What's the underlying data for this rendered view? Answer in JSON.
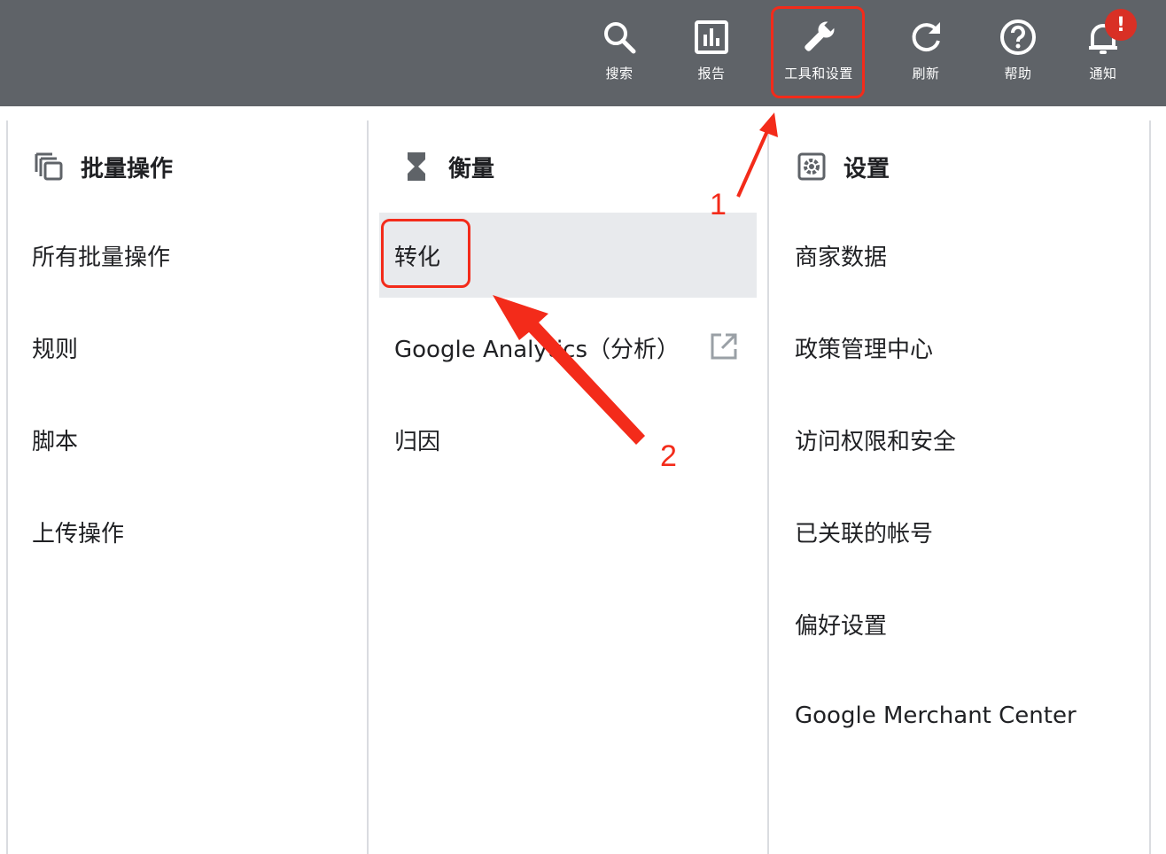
{
  "toolbar": {
    "search": "搜索",
    "reports": "报告",
    "tools_settings": "工具和设置",
    "refresh": "刷新",
    "help": "帮助",
    "notifications": "通知",
    "notification_badge": "!"
  },
  "columns": {
    "bulk": {
      "title": "批量操作",
      "items": [
        "所有批量操作",
        "规则",
        "脚本",
        "上传操作"
      ]
    },
    "measurement": {
      "title": "衡量",
      "items": [
        "转化",
        "Google Analytics（分析）",
        "归因"
      ],
      "active_index": 0
    },
    "setup": {
      "title": "设置",
      "items": [
        "商家数据",
        "政策管理中心",
        "访问权限和安全",
        "已关联的帐号",
        "偏好设置",
        "Google Merchant Center"
      ]
    }
  },
  "annotations": {
    "step1": "1",
    "step2": "2",
    "color": "#f32b1a"
  },
  "colors": {
    "topbar": "#5f6368",
    "active_row": "#e8eaed",
    "badge": "#d93025"
  }
}
